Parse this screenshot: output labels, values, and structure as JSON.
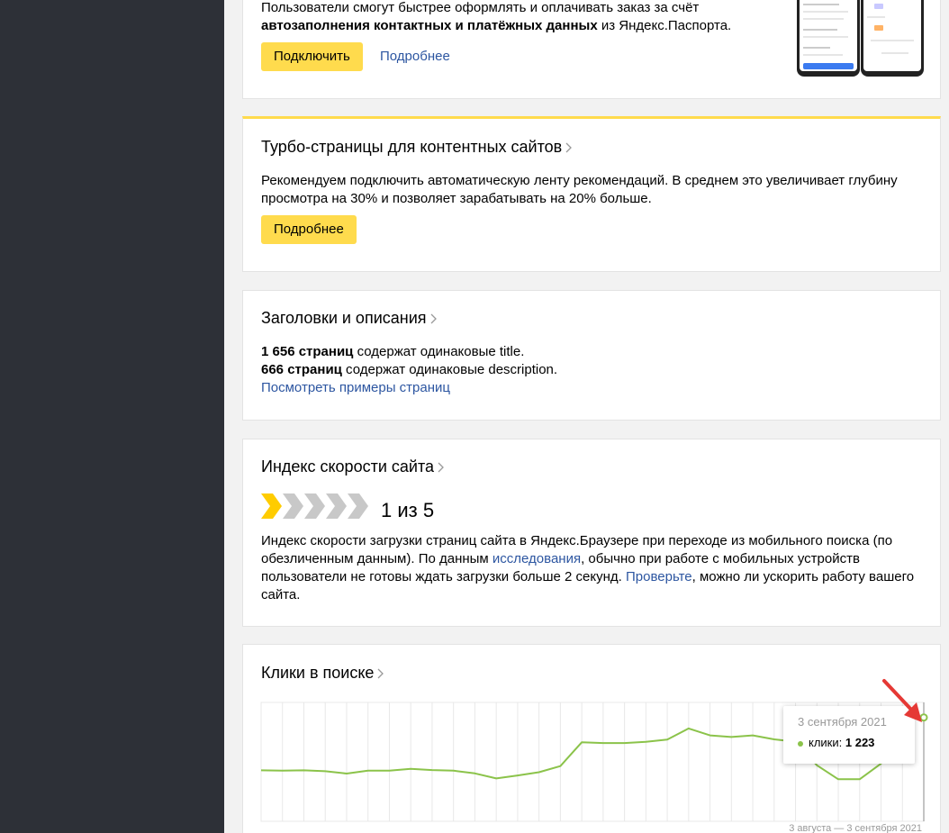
{
  "card1": {
    "text_line1": "Пользователи смогут быстрее оформлять и оплачивать заказ за счёт",
    "text_bold": "автозаполнения контактных и платёжных данных",
    "text_tail": " из Яндекс.Паспорта.",
    "connect_label": "Подключить",
    "more_label": "Подробнее"
  },
  "card2": {
    "title": "Турбо-страницы для контентных сайтов",
    "text": "Рекомендуем подключить автоматическую ленту рекомендаций. В среднем это увеличивает глубину просмотра на 30% и позволяет зарабатывать на 20% больше.",
    "more_label": "Подробнее",
    "accent_color": "#ffdb4d"
  },
  "card3": {
    "title": "Заголовки и описания",
    "line1_bold": "1 656 страниц",
    "line1_rest": " содержат одинаковые title.",
    "line2_bold": "666 страниц",
    "line2_rest": " содержат одинаковые description.",
    "examples_link": "Посмотреть примеры страниц"
  },
  "card4": {
    "title": "Индекс скорости сайта",
    "speed_value": "1 из 5",
    "speed_level": 1,
    "speed_max": 5,
    "text_a": "Индекс скорости загрузки страниц сайта в Яндекс.Браузере при переходе из мобильного поиска (по обезличенным данным). По данным ",
    "link_research": "исследования",
    "text_b": ", обычно при работе с мобильных устройств пользователи не готовы ждать загрузки больше 2 секунд. ",
    "link_check": "Проверьте",
    "text_c": ", можно ли ускорить работу вашего сайта."
  },
  "card5": {
    "title": "Клики в поиске",
    "tooltip_date": "3 сентября 2021",
    "tooltip_label": "клики:",
    "tooltip_value": "1 223",
    "date_range": "3 августа — 3 сентября 2021"
  },
  "colors": {
    "sidebar": "#2d3037",
    "button": "#ffdb4d",
    "link": "#2d56a1",
    "line": "#8bc34a",
    "arrow": "#e53935"
  },
  "chart_data": {
    "type": "line",
    "title": "Клики в поиске",
    "xlabel": "",
    "ylabel": "",
    "x": [
      "3 августа",
      "4 августа",
      "5 августа",
      "6 августа",
      "7 августа",
      "8 августа",
      "9 августа",
      "10 августа",
      "11 августа",
      "12 августа",
      "13 августа",
      "14 августа",
      "15 августа",
      "16 августа",
      "17 августа",
      "18 августа",
      "19 августа",
      "20 августа",
      "21 августа",
      "22 августа",
      "23 августа",
      "24 августа",
      "25 августа",
      "26 августа",
      "27 августа",
      "28 августа",
      "29 августа",
      "30 августа",
      "31 августа",
      "1 сентября",
      "2 сентября",
      "3 сентября"
    ],
    "series": [
      {
        "name": "клики",
        "values": [
          600,
          597,
          600,
          590,
          562,
          597,
          597,
          617,
          603,
          596,
          564,
          505,
          540,
          578,
          650,
          930,
          922,
          922,
          935,
          962,
          1093,
          1012,
          993,
          1012,
          965,
          938,
          660,
          495,
          495,
          680,
          1223,
          1223
        ]
      }
    ],
    "ylim": [
      0,
      1400
    ],
    "grid": true,
    "legend": "none"
  }
}
